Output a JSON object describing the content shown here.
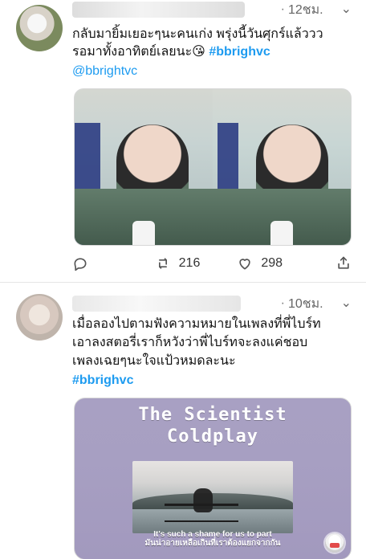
{
  "tweets": [
    {
      "time": "12ชม.",
      "text_line_1": "กลับมายิ้มเยอะๆนะคนเก่ง พรุ่งนี้วันศุกร์แล้ววว",
      "text_line_2_prefix": "รอมาทั้งอาทิตย์เลยนะ😘 ",
      "text_line_2_hashtag": "#bbrighvc",
      "mention": "@bbrightvc",
      "actions": {
        "retweets": "216",
        "likes": "298"
      }
    },
    {
      "time": "10ชม.",
      "text_lines": [
        "เมื่อลองไปตามฟังความหมายในเพลงที่พี่ไบร์ท",
        "เอาลงสตอรี่เราก็หวังว่าพี่ไบร์ทจะลงแค่ชอบ",
        "เพลงเฉยๆนะใจแป้วหมดละนะ"
      ],
      "hashtag": "#bbrighvc",
      "media_title_1": "The Scientist",
      "media_title_2": "Coldplay",
      "caption_en": "It's such a shame for us to part",
      "caption_th": "มันน่าอายเหลือเกินที่เราต้องแยกจากกัน"
    }
  ],
  "icons": {
    "reply": "reply-icon",
    "retweet": "retweet-icon",
    "like": "like-icon",
    "share": "share-icon",
    "more": "chevron-down-icon"
  },
  "colors": {
    "link_blue": "#1d9bf0",
    "text": "#111111",
    "muted": "#666666"
  }
}
